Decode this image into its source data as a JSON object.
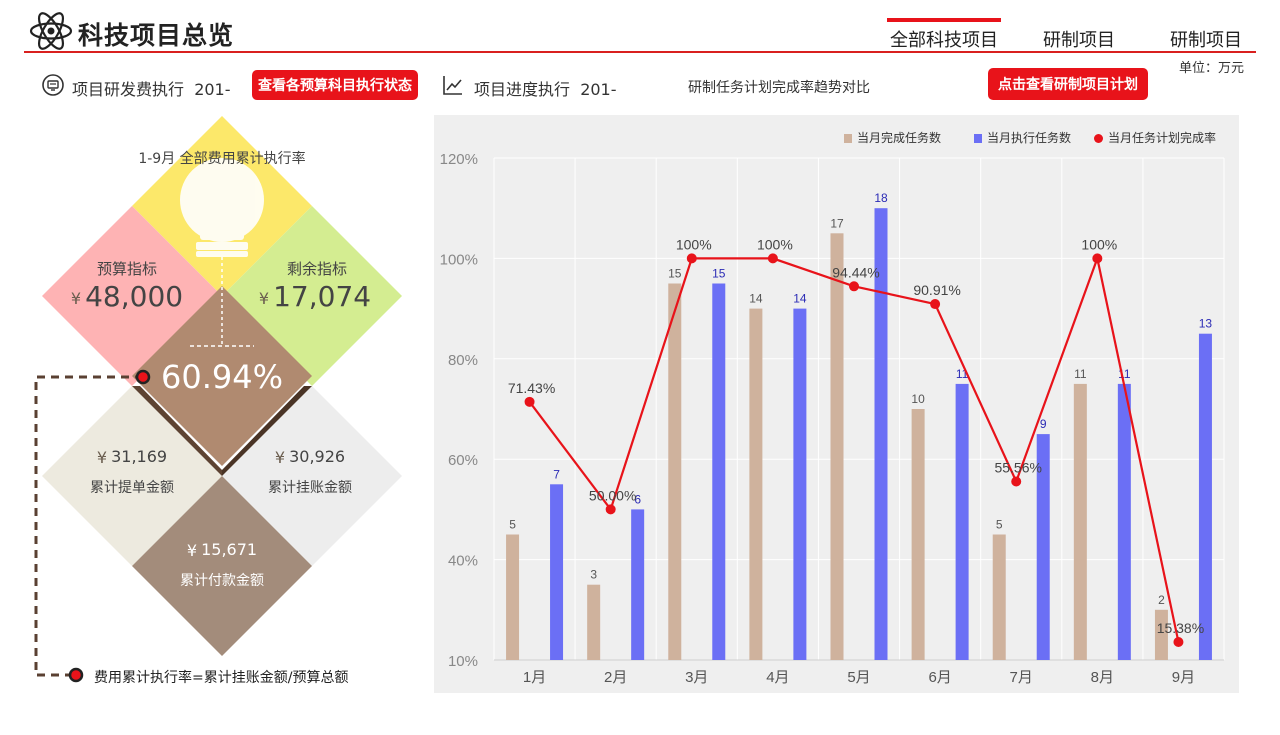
{
  "header": {
    "title": "科技项目总览",
    "nav": [
      "全部科技项目",
      "研制项目",
      "研制项目"
    ],
    "unit": "单位：万元"
  },
  "subheader": {
    "budget_label": "项目研发费执行",
    "budget_year": "201-",
    "budget_button": "查看各预算科目执行状态",
    "progress_label": "项目进度执行",
    "progress_year": "201-",
    "chart_subtitle": "研制任务计划完成率趋势对比",
    "plan_button": "点击查看研制项目计划"
  },
  "diamonds": {
    "top_caption": "1-9月 全部费用累计执行率",
    "budget_label": "预算指标",
    "budget_value": "48,000",
    "remaining_label": "剩余指标",
    "remaining_value": "17,074",
    "rate_value": "60.94%",
    "submitted_value": "31,169",
    "submitted_label": "累计提单金额",
    "booked_value": "30,926",
    "booked_label": "累计挂账金额",
    "paid_value": "15,671",
    "paid_label": "累计付款金额",
    "currency_symbol": "¥",
    "formula": "费用累计执行率=累计挂账金额/预算总额",
    "colors": {
      "top": "#fce86a",
      "left": "#feb3b4",
      "right": "#d4ed91",
      "center": "#b08a70",
      "lower_left": "#edeadf",
      "lower_right": "#ededed",
      "bottom": "#a38c7b"
    }
  },
  "chart_data": {
    "type": "bar",
    "categories": [
      "1月",
      "2月",
      "3月",
      "4月",
      "5月",
      "6月",
      "7月",
      "8月",
      "9月"
    ],
    "series": [
      {
        "name": "当月完成任务数",
        "type": "bar",
        "color": "#cfb29d",
        "values": [
          5,
          3,
          15,
          14,
          17,
          10,
          5,
          11,
          2
        ]
      },
      {
        "name": "当月执行任务数",
        "type": "bar",
        "color": "#6b6ff5",
        "values": [
          7,
          6,
          15,
          14,
          18,
          11,
          9,
          11,
          13
        ]
      },
      {
        "name": "当月任务计划完成率",
        "type": "line",
        "color": "#e8131a",
        "values": [
          71.43,
          50.0,
          100,
          100,
          94.44,
          90.91,
          55.56,
          100,
          15.38
        ],
        "labels": [
          "71.43%",
          "50.00%",
          "100%",
          "100%",
          "94.44%",
          "90.91%",
          "55.56%",
          "100%",
          "15.38%"
        ]
      }
    ],
    "y_ticks": [
      "120%",
      "100%",
      "80%",
      "60%",
      "40%",
      "10%"
    ],
    "y_tick_values": [
      120,
      100,
      80,
      60,
      40,
      10
    ],
    "bar_max": 20,
    "bar_min": 0,
    "grid": true,
    "legend_position": "top-right"
  }
}
